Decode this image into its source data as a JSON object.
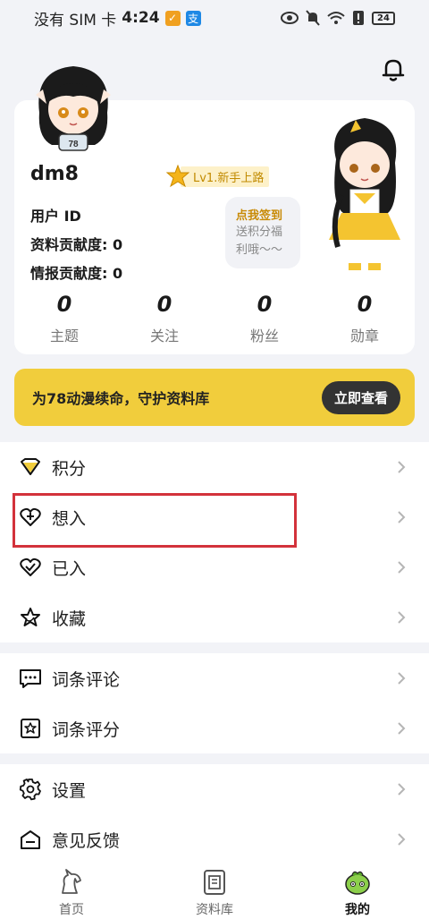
{
  "status": {
    "carrier": "没有 SIM 卡",
    "time": "4:24",
    "battery": "24"
  },
  "profile": {
    "username": "dm8",
    "level": "Lv1.新手上路",
    "user_id_label": "用户 ID",
    "data_contrib": "资料贡献度: 0",
    "intel_contrib": "情报贡献度: 0",
    "checkin_title": "点我签到",
    "checkin_sub1": "送积分福",
    "checkin_sub2": "利哦～～",
    "jersey": "78"
  },
  "stats": [
    {
      "num": "0",
      "label": "主题"
    },
    {
      "num": "0",
      "label": "关注"
    },
    {
      "num": "0",
      "label": "粉丝"
    },
    {
      "num": "0",
      "label": "勋章"
    }
  ],
  "banner": {
    "text": "为78动漫续命，守护资料库",
    "button": "立即查看"
  },
  "menu1": [
    {
      "label": "积分",
      "icon": "diamond-icon"
    },
    {
      "label": "想入",
      "icon": "heart-plus-icon"
    },
    {
      "label": "已入",
      "icon": "heart-check-icon"
    },
    {
      "label": "收藏",
      "icon": "star-icon"
    }
  ],
  "menu2": [
    {
      "label": "词条评论",
      "icon": "comment-icon"
    },
    {
      "label": "词条评分",
      "icon": "rating-icon"
    }
  ],
  "menu3": [
    {
      "label": "设置",
      "icon": "gear-icon"
    },
    {
      "label": "意见反馈",
      "icon": "feedback-icon"
    }
  ],
  "tabs": [
    {
      "label": "首页"
    },
    {
      "label": "资料库"
    },
    {
      "label": "我的"
    }
  ],
  "colors": {
    "accent": "#f1cd3c",
    "highlight": "#d3323b"
  }
}
